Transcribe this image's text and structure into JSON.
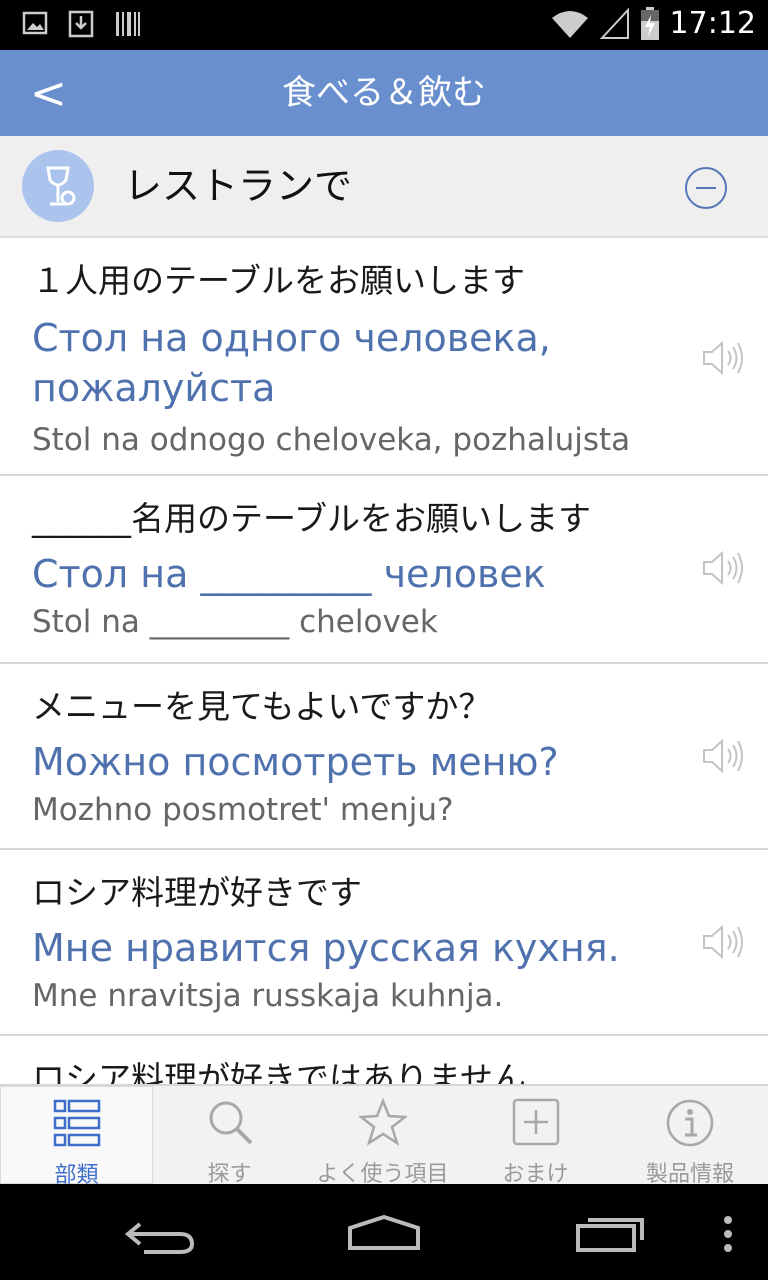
{
  "status_bar": {
    "time": "17:12"
  },
  "header": {
    "back_label": "<",
    "title": "食べる＆飲む"
  },
  "section": {
    "title": "レストランで"
  },
  "phrases": [
    {
      "ja": "１人用のテーブルをお願いします",
      "ru": "Стол на одного человека, пожалуйста",
      "translit": "Stol na odnogo cheloveka, pozhalujsta"
    },
    {
      "ja": "______名用のテーブルをお願いします",
      "ru": "Стол на _________ человек",
      "translit": "Stol na _________ chelovek"
    },
    {
      "ja": "メニューを見てもよいですか？",
      "ru": "Можно посмотреть меню?",
      "translit": "Mozhno posmotret' menju?"
    },
    {
      "ja": "ロシア料理が好きです",
      "ru": "Мне нравится русская кухня.",
      "translit": "Mne nravitsja russkaja kuhnja."
    },
    {
      "ja": "ロシア料理が好きではありません"
    }
  ],
  "bottom_nav": [
    {
      "label": "部類",
      "icon": "list-grid-icon",
      "active": true
    },
    {
      "label": "探す",
      "icon": "magnifier-icon"
    },
    {
      "label": "よく使う項目",
      "icon": "star-icon"
    },
    {
      "label": "おまけ",
      "icon": "plus-box-icon"
    },
    {
      "label": "製品情報",
      "icon": "info-icon"
    }
  ],
  "colors": {
    "app_bar": "#6a8fcf",
    "accent": "#3d6fc9",
    "russian_text": "#4f71ad"
  }
}
